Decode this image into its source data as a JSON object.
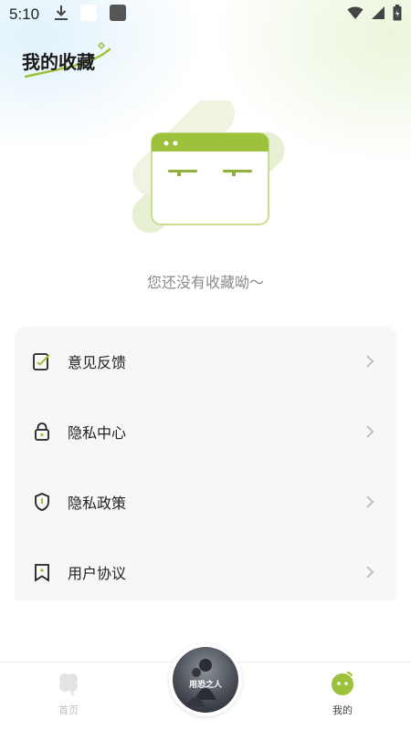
{
  "status_bar": {
    "time": "5:10"
  },
  "header": {
    "title": "我的收藏"
  },
  "empty_state": {
    "message": "您还没有收藏呦～"
  },
  "menu": {
    "items": [
      {
        "label": "意见反馈",
        "icon": "feedback-edit-icon"
      },
      {
        "label": "隐私中心",
        "icon": "lock-icon"
      },
      {
        "label": "隐私政策",
        "icon": "shield-icon"
      },
      {
        "label": "用户协议",
        "icon": "bookmark-icon"
      }
    ]
  },
  "bottom_nav": {
    "home_label": "首页",
    "mine_label": "我的",
    "center_cover_text": "用恐之人"
  },
  "colors": {
    "accent": "#9dc13a",
    "accent_light": "#e8f0d3",
    "menu_bg": "#f7f7f7",
    "text_muted": "#8a8a8a"
  }
}
